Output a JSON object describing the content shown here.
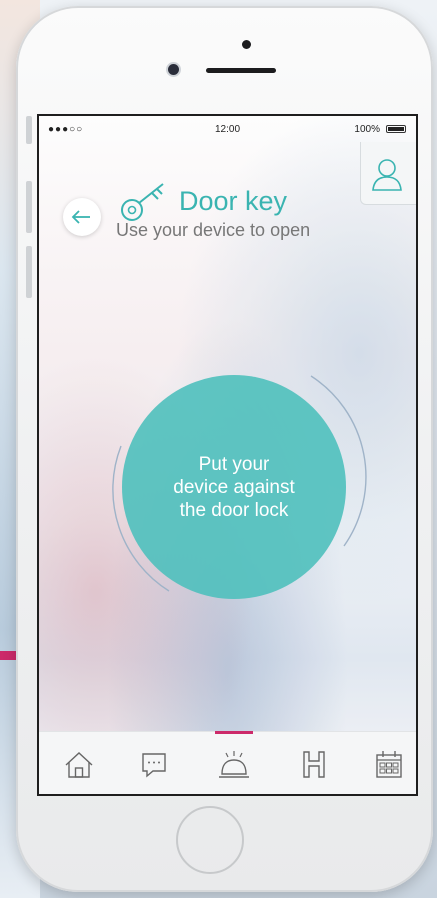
{
  "status_bar": {
    "signal": "●●●○○",
    "time": "12:00",
    "battery": "100%"
  },
  "header": {
    "title": "Door key",
    "subtitle": "Use your device to open"
  },
  "main": {
    "instruction": "Put your\ndevice against\nthe door lock"
  },
  "tab_bar": {
    "items": [
      {
        "icon": "home-icon"
      },
      {
        "icon": "chat-icon"
      },
      {
        "icon": "bell-icon",
        "active": true
      },
      {
        "icon": "hotel-icon"
      },
      {
        "icon": "calendar-icon"
      }
    ]
  },
  "colors": {
    "accent": "#3ab4b1",
    "circle": "#4fc0bc",
    "active_indicator": "#cc2a6a"
  }
}
